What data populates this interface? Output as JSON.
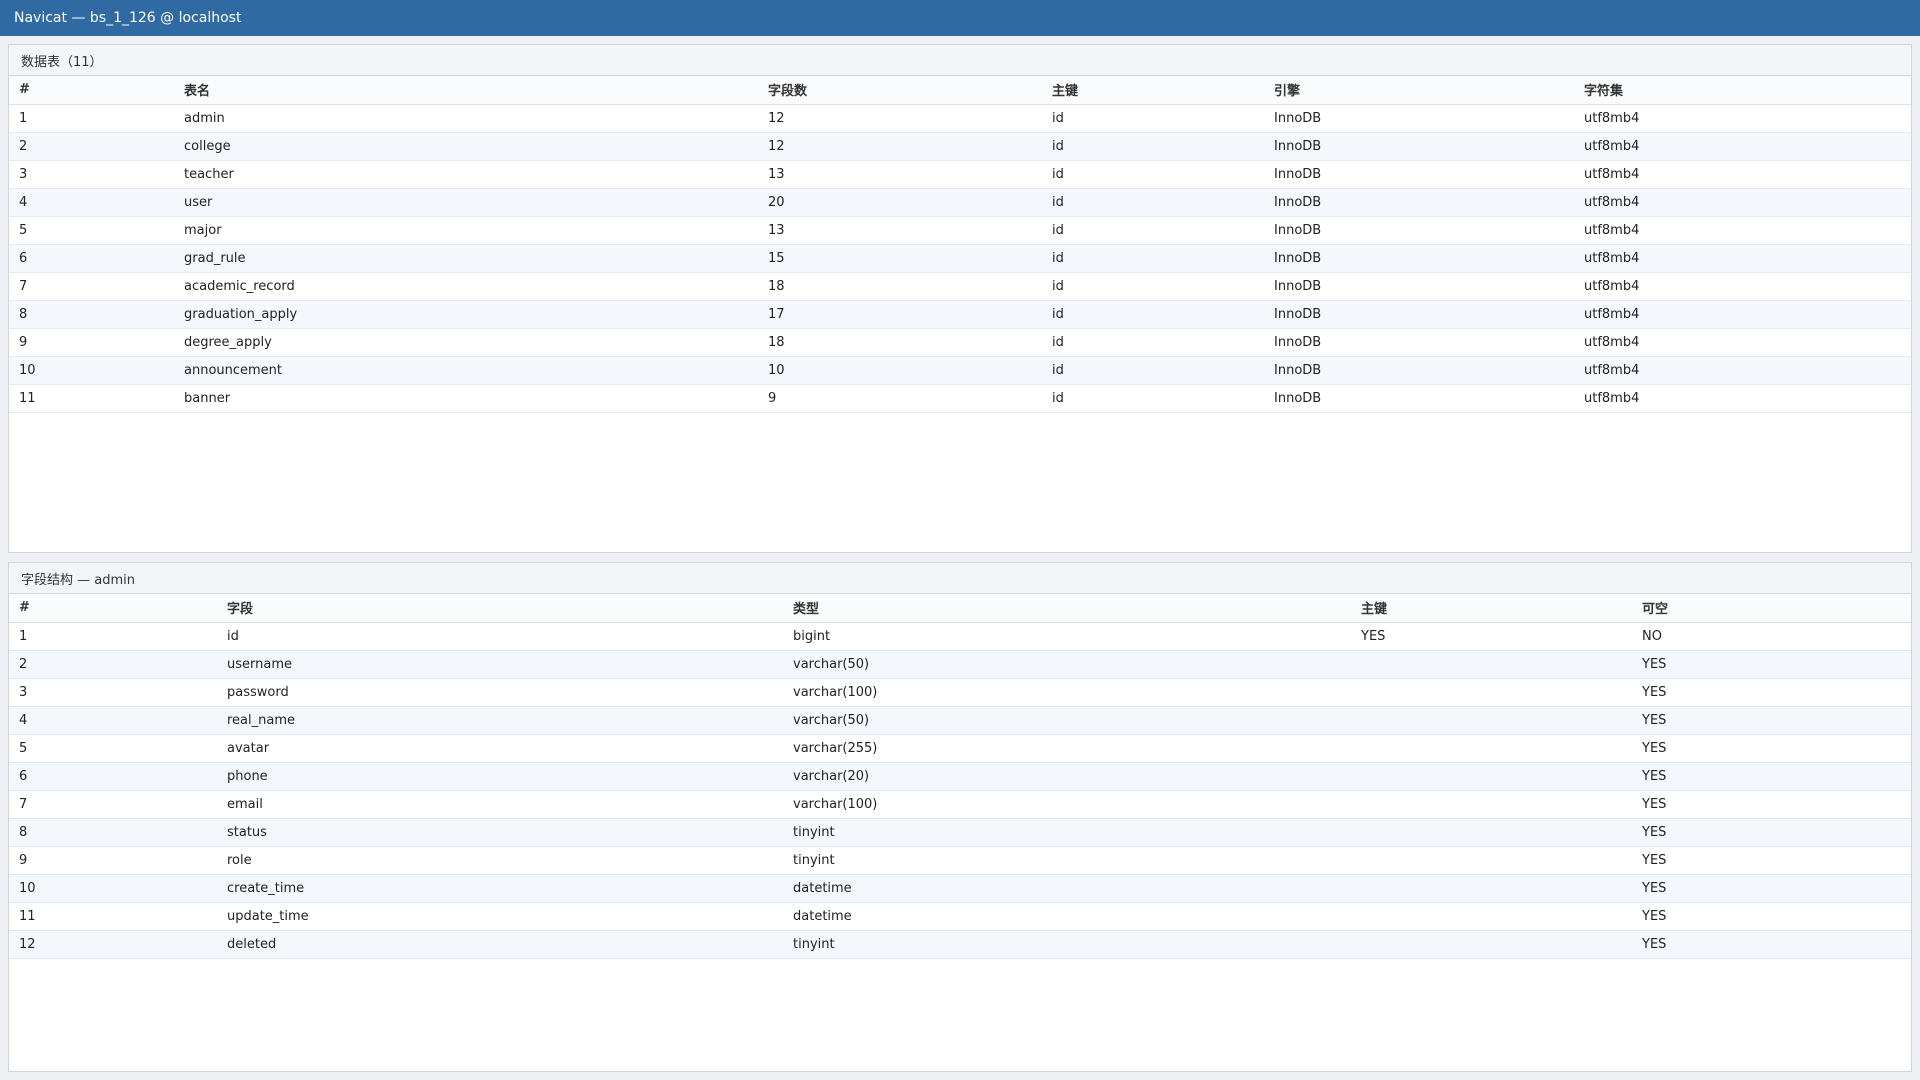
{
  "window": {
    "title": "Navicat — bs_1_126 @ localhost"
  },
  "tables_panel": {
    "title": "数据表（11）",
    "columns": [
      "#",
      "表名",
      "字段数",
      "主键",
      "引擎",
      "字符集"
    ],
    "rows": [
      [
        "1",
        "admin",
        "12",
        "id",
        "InnoDB",
        "utf8mb4"
      ],
      [
        "2",
        "college",
        "12",
        "id",
        "InnoDB",
        "utf8mb4"
      ],
      [
        "3",
        "teacher",
        "13",
        "id",
        "InnoDB",
        "utf8mb4"
      ],
      [
        "4",
        "user",
        "20",
        "id",
        "InnoDB",
        "utf8mb4"
      ],
      [
        "5",
        "major",
        "13",
        "id",
        "InnoDB",
        "utf8mb4"
      ],
      [
        "6",
        "grad_rule",
        "15",
        "id",
        "InnoDB",
        "utf8mb4"
      ],
      [
        "7",
        "academic_record",
        "18",
        "id",
        "InnoDB",
        "utf8mb4"
      ],
      [
        "8",
        "graduation_apply",
        "17",
        "id",
        "InnoDB",
        "utf8mb4"
      ],
      [
        "9",
        "degree_apply",
        "18",
        "id",
        "InnoDB",
        "utf8mb4"
      ],
      [
        "10",
        "announcement",
        "10",
        "id",
        "InnoDB",
        "utf8mb4"
      ],
      [
        "11",
        "banner",
        "9",
        "id",
        "InnoDB",
        "utf8mb4"
      ]
    ]
  },
  "fields_panel": {
    "title": "字段结构 — admin",
    "columns": [
      "#",
      "字段",
      "类型",
      "主键",
      "可空"
    ],
    "rows": [
      [
        "1",
        "id",
        "bigint",
        "YES",
        "NO"
      ],
      [
        "2",
        "username",
        "varchar(50)",
        "",
        "YES"
      ],
      [
        "3",
        "password",
        "varchar(100)",
        "",
        "YES"
      ],
      [
        "4",
        "real_name",
        "varchar(50)",
        "",
        "YES"
      ],
      [
        "5",
        "avatar",
        "varchar(255)",
        "",
        "YES"
      ],
      [
        "6",
        "phone",
        "varchar(20)",
        "",
        "YES"
      ],
      [
        "7",
        "email",
        "varchar(100)",
        "",
        "YES"
      ],
      [
        "8",
        "status",
        "tinyint",
        "",
        "YES"
      ],
      [
        "9",
        "role",
        "tinyint",
        "",
        "YES"
      ],
      [
        "10",
        "create_time",
        "datetime",
        "",
        "YES"
      ],
      [
        "11",
        "update_time",
        "datetime",
        "",
        "YES"
      ],
      [
        "12",
        "deleted",
        "tinyint",
        "",
        "YES"
      ]
    ]
  }
}
